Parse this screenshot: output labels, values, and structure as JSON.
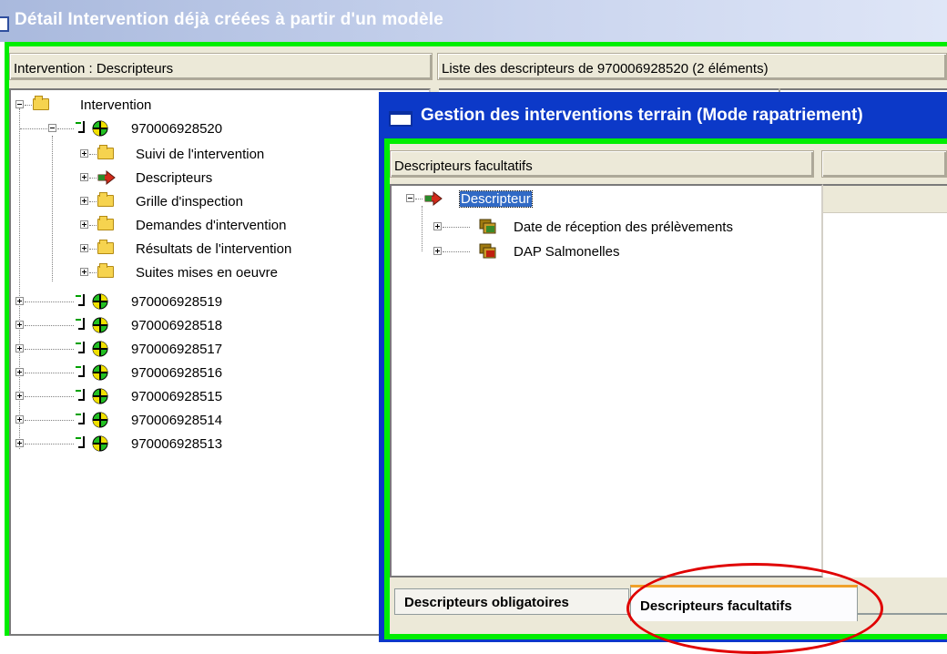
{
  "back_window": {
    "title": "Détail Intervention déjà créées à partir d'un modèle",
    "left_header": "Intervention : Descripteurs",
    "right_header": "Liste des descripteurs de  970006928520 (2 éléments)",
    "tree": {
      "root": "Intervention",
      "expanded_item": "970006928520",
      "children": [
        "Suivi de l'intervention",
        "Descripteurs",
        "Grille d'inspection",
        "Demandes d'intervention",
        "Résultats de l'intervention",
        "Suites mises en oeuvre"
      ],
      "siblings": [
        "970006928519",
        "970006928518",
        "970006928517",
        "970006928516",
        "970006928515",
        "970006928514",
        "970006928513"
      ]
    }
  },
  "dialog": {
    "title": "Gestion des interventions terrain (Mode rapatriement)",
    "left_header": "Descripteurs facultatifs",
    "tree": {
      "root": "Descripteur",
      "items": [
        "Date de réception des prélèvements",
        "DAP Salmonelles"
      ]
    },
    "tabs": [
      "Descripteurs obligatoires",
      "Descripteurs facultatifs"
    ],
    "active_tab": "Descripteurs facultatifs"
  },
  "colors": {
    "green_frame": "#00ee00",
    "dialog_titlebar": "#0c39c8",
    "highlight": "#e00000",
    "selection": "#316ac5"
  }
}
